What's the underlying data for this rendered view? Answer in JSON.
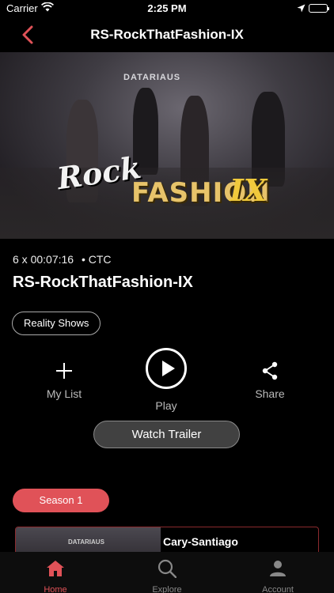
{
  "status_bar": {
    "carrier": "Carrier",
    "time": "2:25 PM"
  },
  "nav": {
    "title": "RS-RockThatFashion-IX",
    "accent": "#e05258"
  },
  "hero": {
    "sponsor_text": "DATARIAUS",
    "logo_rock": "Rock",
    "logo_fashion": "FASHION",
    "logo_ix": "IX"
  },
  "meta": {
    "episodes_duration": "6 x 00:07:16",
    "network": "• CTC"
  },
  "show": {
    "title": "RS-RockThatFashion-IX",
    "genre": "Reality Shows"
  },
  "actions": {
    "my_list": "My List",
    "play": "Play",
    "share": "Share",
    "watch_trailer": "Watch Trailer"
  },
  "season": {
    "label": "Season 1"
  },
  "episodes": [
    {
      "title": "Cary-Santiago",
      "sponsor_text": "DATARIAUS"
    }
  ],
  "tabs": [
    {
      "label": "Home",
      "icon": "home-icon",
      "active": true
    },
    {
      "label": "Explore",
      "icon": "search-icon",
      "active": false
    },
    {
      "label": "Account",
      "icon": "account-icon",
      "active": false
    }
  ]
}
